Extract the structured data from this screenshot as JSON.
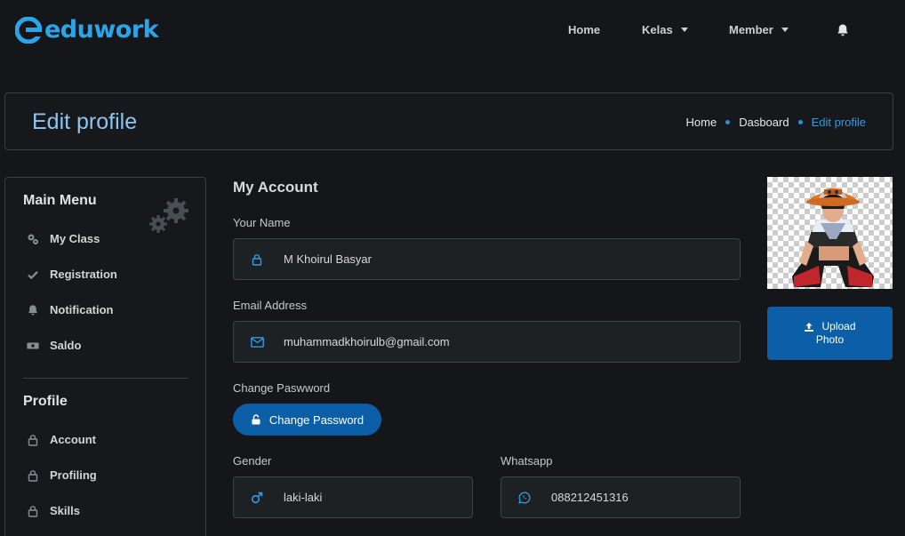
{
  "brand": {
    "name": "eduwork",
    "color": "#2aa6e8"
  },
  "nav": {
    "home": "Home",
    "kelas": "Kelas",
    "member": "Member"
  },
  "header": {
    "title": "Edit profile",
    "breadcrumb": [
      "Home",
      "Dasboard",
      "Edit profile"
    ]
  },
  "sidebar": {
    "main_heading": "Main Menu",
    "main_items": [
      {
        "label": "My Class",
        "icon": "gears-icon"
      },
      {
        "label": "Registration",
        "icon": "check-icon"
      },
      {
        "label": "Notification",
        "icon": "bell-icon"
      },
      {
        "label": "Saldo",
        "icon": "money-icon"
      }
    ],
    "profile_heading": "Profile",
    "profile_items": [
      {
        "label": "Account",
        "icon": "lock-icon"
      },
      {
        "label": "Profiling",
        "icon": "lock-icon"
      },
      {
        "label": "Skills",
        "icon": "lock-icon"
      }
    ]
  },
  "account": {
    "title": "My Account",
    "name_label": "Your Name",
    "name_value": "M Khoirul Basyar",
    "email_label": "Email Address",
    "email_value": "muhammadkhoirulb@gmail.com",
    "password_label": "Change Paswword",
    "password_button": "Change Password",
    "gender_label": "Gender",
    "gender_value": "laki-laki",
    "whatsapp_label": "Whatsapp",
    "whatsapp_value": "088212451316"
  },
  "photo": {
    "upload_line1": "Upload",
    "upload_line2": "Photo"
  },
  "colors": {
    "accent": "#0c5fa7",
    "link": "#2f9ae6",
    "background": "#141619",
    "title": "#8ec5f0"
  }
}
